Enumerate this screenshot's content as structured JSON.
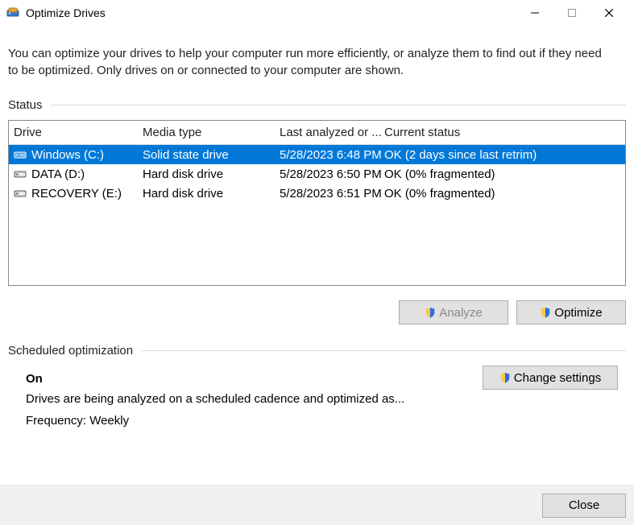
{
  "window": {
    "title": "Optimize Drives",
    "description": "You can optimize your drives to help your computer run more efficiently, or analyze them to find out if they need to be optimized. Only drives on or connected to your computer are shown."
  },
  "sections": {
    "status_label": "Status",
    "scheduled_label": "Scheduled optimization"
  },
  "columns": {
    "drive": "Drive",
    "media": "Media type",
    "last": "Last analyzed or ...",
    "status": "Current status"
  },
  "drives": [
    {
      "name": "Windows (C:)",
      "media": "Solid state drive",
      "last": "5/28/2023 6:48 PM",
      "status": "OK (2 days since last retrim)",
      "selected": true,
      "icon": "ssd"
    },
    {
      "name": "DATA (D:)",
      "media": "Hard disk drive",
      "last": "5/28/2023 6:50 PM",
      "status": "OK (0% fragmented)",
      "selected": false,
      "icon": "hdd"
    },
    {
      "name": "RECOVERY (E:)",
      "media": "Hard disk drive",
      "last": "5/28/2023 6:51 PM",
      "status": "OK (0% fragmented)",
      "selected": false,
      "icon": "hdd"
    }
  ],
  "buttons": {
    "analyze": "Analyze",
    "optimize": "Optimize",
    "change_settings": "Change settings",
    "close": "Close"
  },
  "schedule": {
    "state": "On",
    "desc": "Drives are being analyzed on a scheduled cadence and optimized as...",
    "frequency": "Frequency: Weekly"
  }
}
